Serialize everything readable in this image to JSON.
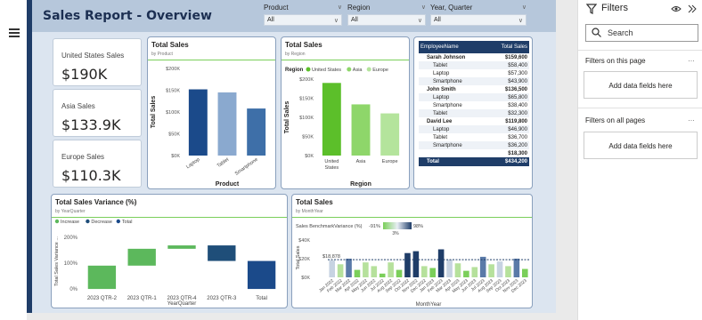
{
  "header": {
    "title": "Sales Report - Overview"
  },
  "slicers": [
    {
      "label": "Product",
      "value": "All"
    },
    {
      "label": "Region",
      "value": "All"
    },
    {
      "label": "Year, Quarter",
      "value": "All"
    }
  ],
  "kpis": [
    {
      "label": "United States Sales",
      "value": "$190K"
    },
    {
      "label": "Asia Sales",
      "value": "$133.9K"
    },
    {
      "label": "Europe Sales",
      "value": "$110.3K"
    }
  ],
  "product_card": {
    "title": "Total Sales",
    "subtitle": "by Product"
  },
  "region_card": {
    "title": "Total Sales",
    "subtitle": "by Region",
    "legend_title": "Region"
  },
  "variance_card": {
    "title": "Total Sales Variance (%)",
    "subtitle": "by YearQuarter"
  },
  "month_card": {
    "title": "Total Sales",
    "subtitle": "by MonthYear",
    "benchmark_label": "Sales BenchmarkVariance (%)",
    "bench_min": "-91%",
    "bench_mid": "3%",
    "bench_max": "98%",
    "ref_label": "$18,878"
  },
  "table": {
    "headers": [
      "EmployeeName",
      "Total Sales"
    ],
    "rows": [
      {
        "name": "Sarah Johnson",
        "value": "$159,600",
        "level": 0
      },
      {
        "name": "Tablet",
        "value": "$58,400",
        "level": 1
      },
      {
        "name": "Laptop",
        "value": "$57,300",
        "level": 1
      },
      {
        "name": "Smartphone",
        "value": "$43,900",
        "level": 1
      },
      {
        "name": "John Smith",
        "value": "$136,500",
        "level": 0
      },
      {
        "name": "Laptop",
        "value": "$65,800",
        "level": 1
      },
      {
        "name": "Smartphone",
        "value": "$38,400",
        "level": 1
      },
      {
        "name": "Tablet",
        "value": "$32,300",
        "level": 1
      },
      {
        "name": "David Lee",
        "value": "$119,800",
        "level": 0
      },
      {
        "name": "Laptop",
        "value": "$46,900",
        "level": 1
      },
      {
        "name": "Tablet",
        "value": "$36,700",
        "level": 1
      },
      {
        "name": "Smartphone",
        "value": "$36,200",
        "level": 1
      },
      {
        "name": "",
        "value": "$18,300",
        "level": 0
      }
    ],
    "total_label": "Total",
    "total_value": "$434,200"
  },
  "filters": {
    "title": "Filters",
    "search_placeholder": "Search",
    "on_page_label": "Filters on this page",
    "on_page_box": "Add data fields here",
    "all_pages_label": "Filters on all pages",
    "all_pages_box": "Add data fields here"
  },
  "colors": {
    "navy": "#1f3d68",
    "green": "#7bcf5a",
    "blue_dark": "#1b4a8a",
    "blue_light": "#8aa9cf"
  },
  "chart_data": [
    {
      "type": "bar",
      "title": "Total Sales",
      "subtitle": "by Product",
      "xlabel": "Product",
      "ylabel": "Total Sales",
      "categories": [
        "Laptop",
        "Tablet",
        "Smartphone"
      ],
      "values": [
        152000,
        145000,
        108000
      ],
      "ylim": [
        0,
        200000
      ],
      "yticks": [
        "$0K",
        "$50K",
        "$100K",
        "$150K",
        "$200K"
      ],
      "colors": [
        "#1b4a8a",
        "#8aa9cf",
        "#3e6fa8"
      ]
    },
    {
      "type": "bar",
      "title": "Total Sales",
      "subtitle": "by Region",
      "xlabel": "Region",
      "ylabel": "Total Sales",
      "categories": [
        "United States",
        "Asia",
        "Europe"
      ],
      "values": [
        190000,
        133900,
        110300
      ],
      "ylim": [
        0,
        200000
      ],
      "yticks": [
        "$0K",
        "$50K",
        "$100K",
        "$150K",
        "$200K"
      ],
      "legend": [
        "United States",
        "Asia",
        "Europe"
      ],
      "legend_placement": "top",
      "colors": [
        "#5cbf2a",
        "#8ed66a",
        "#b4e49c"
      ]
    },
    {
      "type": "bar",
      "title": "Total Sales Variance (%)",
      "subtitle": "by YearQuarter",
      "xlabel": "YearQuarter",
      "ylabel": "Total Sales Variance ...",
      "legend": [
        "Increase",
        "Decrease",
        "Total"
      ],
      "legend_placement": "top-left",
      "categories": [
        "2023 QTR-2",
        "2023 QTR-1",
        "2023 QTR-4",
        "2023 QTR-3",
        "Total"
      ],
      "waterfall_ranges": [
        [
          0,
          90
        ],
        [
          90,
          155
        ],
        [
          155,
          168
        ],
        [
          168,
          108
        ],
        [
          0,
          108
        ]
      ],
      "kinds": [
        "increase",
        "increase",
        "increase",
        "decrease",
        "total"
      ],
      "ylim": [
        -10,
        230
      ],
      "yticks": [
        "0%",
        "100%",
        "200%"
      ]
    },
    {
      "type": "bar",
      "title": "Total Sales",
      "subtitle": "by MonthYear",
      "xlabel": "MonthYear",
      "ylabel": "Total Sales",
      "categories": [
        "Jan 2022",
        "Feb 2022",
        "Mar 2022",
        "Apr 2022",
        "May 2022",
        "Jun 2022",
        "Jul 2022",
        "Aug 2022",
        "Sep 2022",
        "Oct 2022",
        "Nov 2022",
        "Dec 2022",
        "Jan 2023",
        "Feb 2023",
        "Mar 2023",
        "Apr 2023",
        "May 2023",
        "Jun 2023",
        "Jul 2023",
        "Aug 2023",
        "Sep 2023",
        "Oct 2023",
        "Nov 2023",
        "Dec 2023"
      ],
      "values": [
        18000,
        14000,
        20000,
        8000,
        16000,
        12000,
        4000,
        16000,
        8000,
        26000,
        28000,
        12000,
        10000,
        30000,
        19000,
        15000,
        7000,
        11000,
        22000,
        14000,
        17000,
        12000,
        20000,
        9000
      ],
      "ylim": [
        0,
        40000
      ],
      "yticks": [
        "$0K",
        "$20K",
        "$40K"
      ],
      "reference_line": 18878
    }
  ]
}
